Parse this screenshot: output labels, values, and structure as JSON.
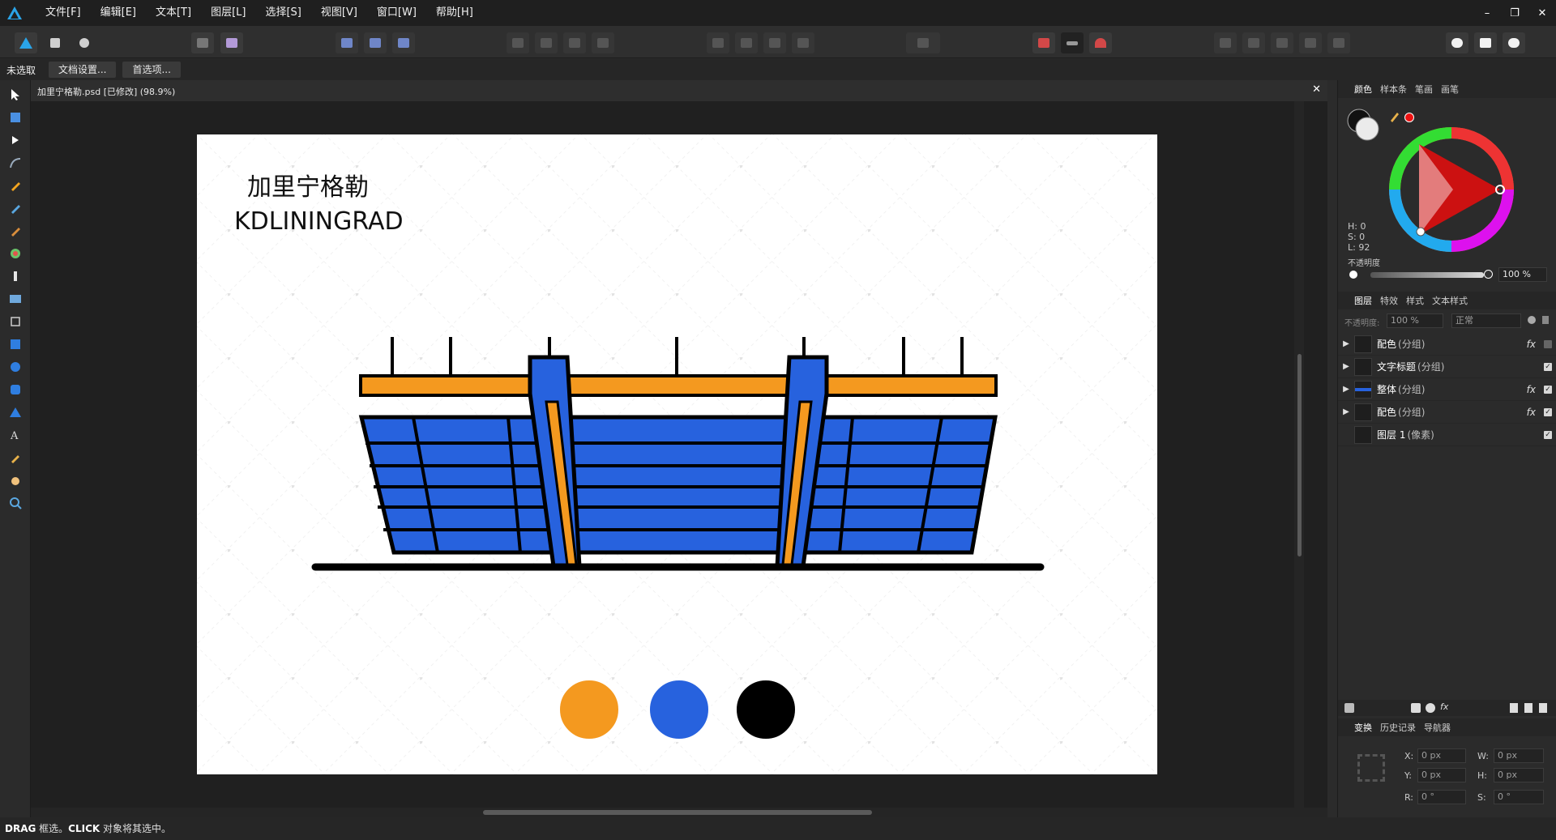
{
  "menu": [
    "文件[F]",
    "编辑[E]",
    "文本[T]",
    "图层[L]",
    "选择[S]",
    "视图[V]",
    "窗口[W]",
    "帮助[H]"
  ],
  "context": {
    "label": "未选取",
    "doc_setup": "文档设置...",
    "prefs": "首选项..."
  },
  "document": {
    "title": "加里宁格勒.psd [已修改] (98.9%)"
  },
  "artwork": {
    "title_cn": "加里宁格勒",
    "title_en": "KDLININGRAD"
  },
  "palette": {
    "orange": "#f4991f",
    "blue": "#2762de",
    "black": "#000000"
  },
  "panels": {
    "color_tabs": [
      "颜色",
      "样本条",
      "笔画",
      "画笔"
    ],
    "hsl": {
      "h": "H: 0",
      "s": "S: 0",
      "l": "L: 92"
    },
    "opacity_label": "不透明度",
    "opacity_value": "100 %",
    "layer_tabs": [
      "图层",
      "特效",
      "样式",
      "文本样式"
    ],
    "layer_opacity_label": "不透明度:",
    "layer_opacity_value": "100 %",
    "blend_mode": "正常",
    "layers": [
      {
        "name": "配色",
        "type": "(分组)",
        "fx": "fx"
      },
      {
        "name": "文字标题",
        "type": "(分组)",
        "fx": ""
      },
      {
        "name": "整体",
        "type": "(分组)",
        "fx": "fx"
      },
      {
        "name": "配色",
        "type": "(分组)",
        "fx": "fx"
      },
      {
        "name": "图层 1",
        "type": "(像素)",
        "fx": ""
      }
    ],
    "transform_tabs": [
      "变换",
      "历史记录",
      "导航器"
    ],
    "transform": {
      "x_label": "X:",
      "x": "0 px",
      "w_label": "W:",
      "w": "0 px",
      "y_label": "Y:",
      "y": "0 px",
      "h_label": "H:",
      "h": "0 px",
      "r_label": "R:",
      "r": "0 °",
      "s_label": "S:",
      "s": "0 °"
    }
  },
  "status": {
    "drag": "DRAG",
    "drag_text": " 框选。",
    "click": "CLICK",
    "click_text": " 对象将其选中。"
  }
}
